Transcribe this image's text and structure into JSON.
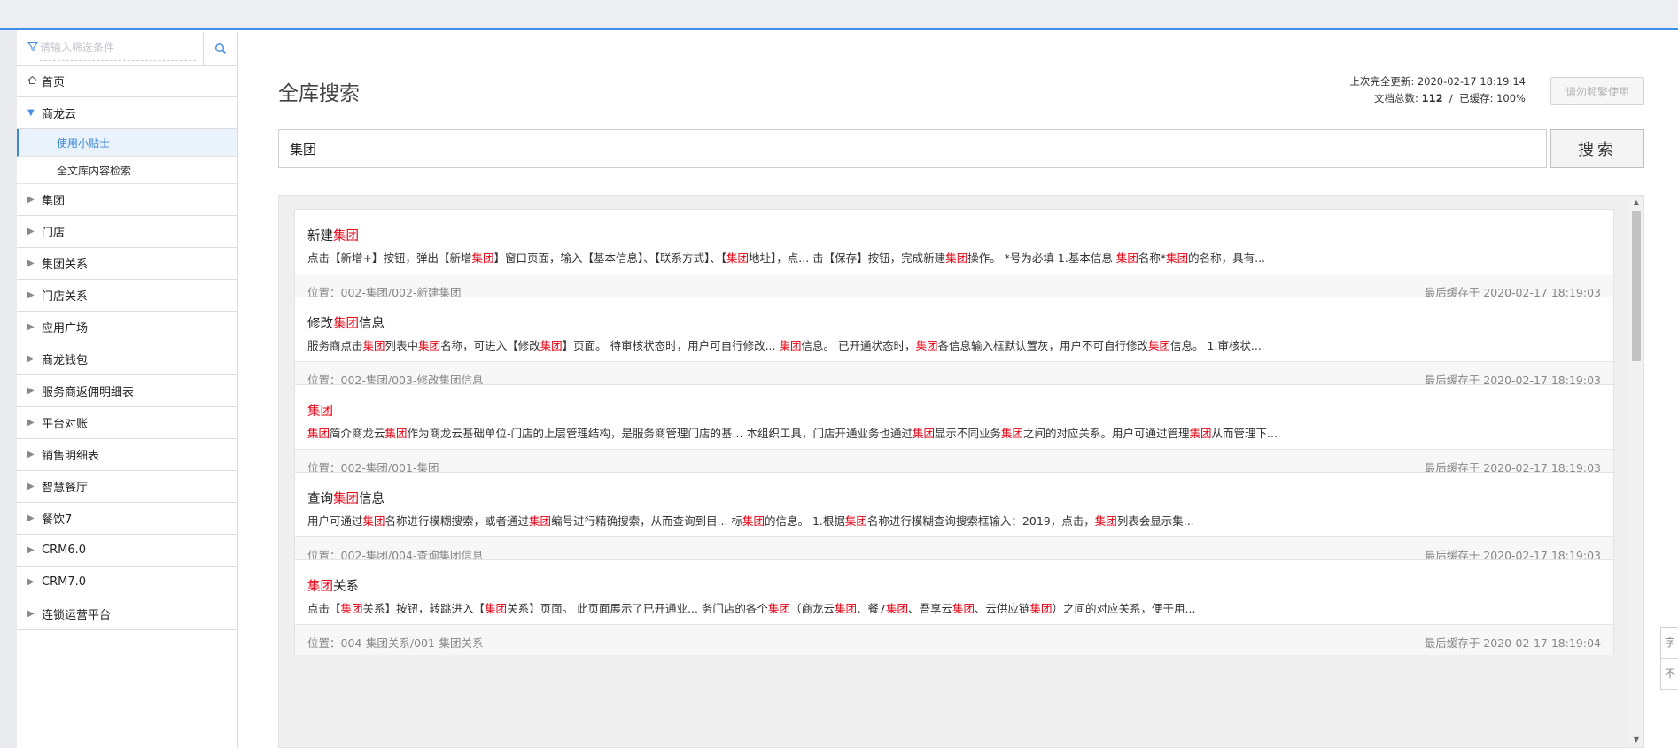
{
  "filter": {
    "placeholder": "请输入筛选条件"
  },
  "nav": {
    "home": "首页",
    "shanglong_cloud": "商龙云",
    "subitems": [
      "使用小贴士",
      "全文库内容检索"
    ],
    "items": [
      "集团",
      "门店",
      "集团关系",
      "门店关系",
      "应用广场",
      "商龙钱包",
      "服务商返佣明细表",
      "平台对账",
      "销售明细表",
      "智慧餐厅",
      "餐饮7",
      "CRM6.0",
      "CRM7.0",
      "连锁运营平台"
    ]
  },
  "page": {
    "title": "全库搜索",
    "last_update_label": "上次完全更新:",
    "last_update_value": "2020-02-17 18:19:14",
    "doc_total_label": "文档总数:",
    "doc_total": "112",
    "cached_label": "已缓存:",
    "cached_value": "100%",
    "disabled_button": "请勿频繁使用",
    "search_value": "集团",
    "search_button": "搜索"
  },
  "results": [
    {
      "title": [
        [
          "新建",
          false
        ],
        [
          "集团",
          true
        ]
      ],
      "snippet": [
        [
          "点击【新增+】按钮，弹出【新增",
          false
        ],
        [
          "集团",
          true
        ],
        [
          "】窗口页面，输入【基本信息】、【联系方式】、【",
          false
        ],
        [
          "集团",
          true
        ],
        [
          "地址】，点... 击【保存】按钮，完成新建",
          false
        ],
        [
          "集团",
          true
        ],
        [
          "操作。 *号为必填 1.基本信息 ",
          false
        ],
        [
          "集团",
          true
        ],
        [
          "名称*",
          false
        ],
        [
          "集团",
          true
        ],
        [
          "的名称，具有...",
          false
        ]
      ],
      "location": "位置：002-集团/002-新建集团",
      "cached": "最后缓存于 2020-02-17 18:19:03"
    },
    {
      "title": [
        [
          "修改",
          false
        ],
        [
          "集团",
          true
        ],
        [
          "信息",
          false
        ]
      ],
      "snippet": [
        [
          "服务商点击",
          false
        ],
        [
          "集团",
          true
        ],
        [
          "列表中",
          false
        ],
        [
          "集团",
          true
        ],
        [
          "名称，可进入【修改",
          false
        ],
        [
          "集团",
          true
        ],
        [
          "】页面。 待审核状态时，用户可自行修改... ",
          false
        ],
        [
          "集团",
          true
        ],
        [
          "信息。 已开通状态时，",
          false
        ],
        [
          "集团",
          true
        ],
        [
          "各信息输入框默认置灰，用户不可自行修改",
          false
        ],
        [
          "集团",
          true
        ],
        [
          "信息。 1.审核状...",
          false
        ]
      ],
      "location": "位置：002-集团/003-修改集团信息",
      "cached": "最后缓存于 2020-02-17 18:19:03"
    },
    {
      "title": [
        [
          "集团",
          true
        ]
      ],
      "snippet": [
        [
          "集团",
          true
        ],
        [
          "简介商龙云",
          false
        ],
        [
          "集团",
          true
        ],
        [
          "作为商龙云基础单位-门店的上层管理结构，是服务商管理门店的基... 本组织工具，门店开通业务也通过",
          false
        ],
        [
          "集团",
          true
        ],
        [
          "显示不同业务",
          false
        ],
        [
          "集团",
          true
        ],
        [
          "之间的对应关系。用户可通过管理",
          false
        ],
        [
          "集团",
          true
        ],
        [
          "从而管理下...",
          false
        ]
      ],
      "location": "位置：002-集团/001-集团",
      "cached": "最后缓存于 2020-02-17 18:19:03"
    },
    {
      "title": [
        [
          "查询",
          false
        ],
        [
          "集团",
          true
        ],
        [
          "信息",
          false
        ]
      ],
      "snippet": [
        [
          "用户可通过",
          false
        ],
        [
          "集团",
          true
        ],
        [
          "名称进行模糊搜索，或者通过",
          false
        ],
        [
          "集团",
          true
        ],
        [
          "编号进行精确搜索，从而查询到目... 标",
          false
        ],
        [
          "集团",
          true
        ],
        [
          "的信息。 1.根据",
          false
        ],
        [
          "集团",
          true
        ],
        [
          "名称进行模糊查询搜索框输入：2019，点击，",
          false
        ],
        [
          "集团",
          true
        ],
        [
          "列表会显示集...",
          false
        ]
      ],
      "location": "位置：002-集团/004-查询集团信息",
      "cached": "最后缓存于 2020-02-17 18:19:03"
    },
    {
      "title": [
        [
          "集团",
          true
        ],
        [
          "关系",
          false
        ]
      ],
      "snippet": [
        [
          "点击【",
          false
        ],
        [
          "集团",
          true
        ],
        [
          "关系】按钮，转跳进入【",
          false
        ],
        [
          "集团",
          true
        ],
        [
          "关系】页面。 此页面展示了已开通业... 务门店的各个",
          false
        ],
        [
          "集团",
          true
        ],
        [
          "（商龙云",
          false
        ],
        [
          "集团",
          true
        ],
        [
          "、餐7",
          false
        ],
        [
          "集团",
          true
        ],
        [
          "、吾享云",
          false
        ],
        [
          "集团",
          true
        ],
        [
          "、云供应链",
          false
        ],
        [
          "集团",
          true
        ],
        [
          "）之间的对应关系，便于用...",
          false
        ]
      ],
      "location": "位置：004-集团关系/001-集团关系",
      "cached": "最后缓存于 2020-02-17 18:19:04"
    }
  ],
  "right_tab": [
    "字",
    "不"
  ],
  "colors": {
    "accent": "#3e8ee6",
    "highlight": "#e60012"
  }
}
